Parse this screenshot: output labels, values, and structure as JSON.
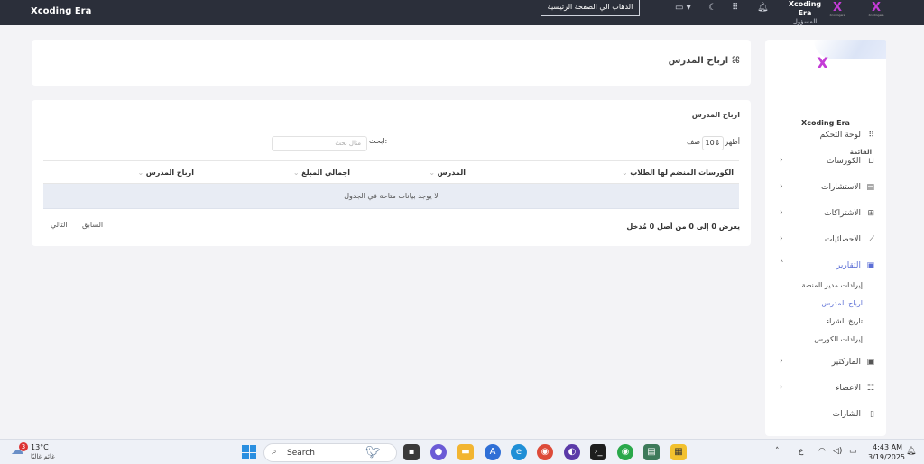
{
  "topbar": {
    "brand": "Xcoding Era",
    "home_button": "الذهاب الي الصفحة الرئيسية",
    "user_name": "Xcoding Era",
    "user_role": "المسؤول",
    "logo_letter": "X",
    "logo_tag": "Xcodingera"
  },
  "sidebar": {
    "logo_letter": "X",
    "brand": "Xcoding Era",
    "menu_title": "القائمة",
    "items": [
      {
        "label": "لوحة التحكم",
        "icon": "grid-icon"
      },
      {
        "label": "الكورسات",
        "icon": "basket-icon"
      },
      {
        "label": "الاستشارات",
        "icon": "file-icon"
      },
      {
        "label": "الاشتراكات",
        "icon": "network-icon"
      },
      {
        "label": "الاحصائيات",
        "icon": "chart-line-icon"
      },
      {
        "label": "التقارير",
        "icon": "archive-icon"
      },
      {
        "label": "الماركتير",
        "icon": "archive-icon"
      },
      {
        "label": "الاعضاء",
        "icon": "users-icon"
      },
      {
        "label": "الشارات",
        "icon": "badge-icon"
      }
    ],
    "sub_items": [
      "إيرادات مدير المنصة",
      "ارباح المدرس",
      "تاريخ الشراء",
      "إيرادات الكورس"
    ]
  },
  "page": {
    "title": "ارباح المدرس"
  },
  "table": {
    "title": "ارباح المدرس",
    "show_label": "أظهر",
    "show_value": "10",
    "show_suffix": "صف",
    "search_label": "ابحث:",
    "search_placeholder": "مثال بحث",
    "columns": [
      "الكورسات المنضم لها الطلاب",
      "المدرس",
      "اجمالي المبلغ",
      "ارباح المدرس"
    ],
    "empty_message": "لا يوجد بيانات متاحة في الجدول",
    "info": "يعرض 0 إلى 0 من أصل 0 مُدخل",
    "prev": "السابق",
    "next": "التالي"
  },
  "taskbar": {
    "weather_temp": "13°C",
    "weather_desc": "غائم غالبًا",
    "weather_badge": "3",
    "search_text": "Search",
    "lang": "ع",
    "time": "4:43 AM",
    "date": "3/19/2025"
  }
}
